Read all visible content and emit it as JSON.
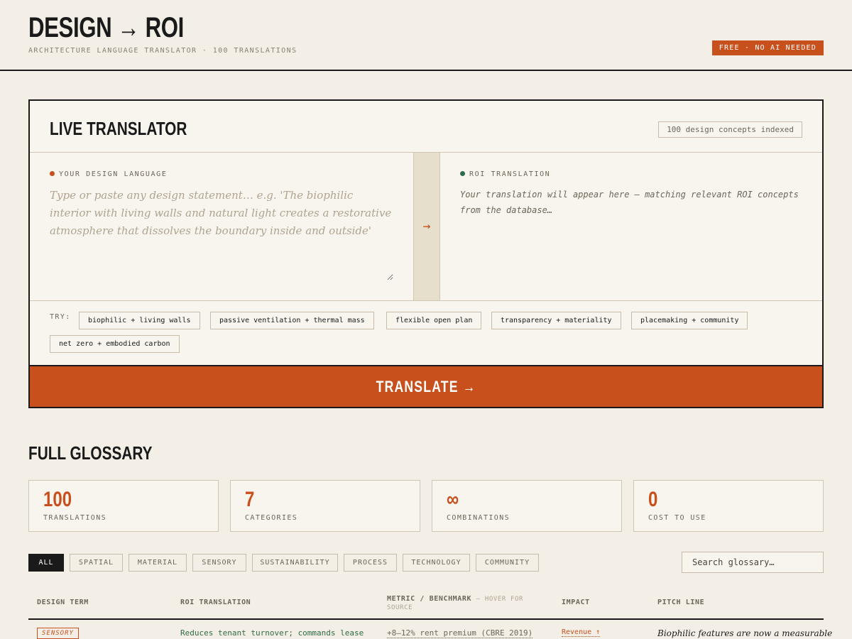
{
  "header": {
    "title": "DESIGN → ROI",
    "subtitle": "ARCHITECTURE LANGUAGE TRANSLATOR · 100 TRANSLATIONS",
    "badge": "FREE · NO AI NEEDED"
  },
  "translator": {
    "title": "LIVE TRANSLATOR",
    "indexed_badge": "100 design concepts indexed",
    "input_label": "YOUR DESIGN LANGUAGE",
    "input_placeholder": "Type or paste any design statement… e.g. 'The biophilic interior with living walls and natural light creates a restorative atmosphere that dissolves the boundary inside and outside'",
    "arrow": "→",
    "output_label": "ROI TRANSLATION",
    "output_placeholder": "Your translation will appear here — matching relevant ROI concepts from the database…",
    "try_label": "TRY:",
    "chips": [
      "biophilic + living walls",
      "passive ventilation + thermal mass",
      "flexible open plan",
      "transparency + materiality",
      "placemaking + community",
      "net zero + embodied carbon"
    ],
    "translate_label": "TRANSLATE →"
  },
  "glossary": {
    "title": "FULL GLOSSARY",
    "stats": [
      {
        "value": "100",
        "label": "TRANSLATIONS"
      },
      {
        "value": "7",
        "label": "CATEGORIES"
      },
      {
        "value": "∞",
        "label": "COMBINATIONS"
      },
      {
        "value": "0",
        "label": "COST TO USE"
      }
    ],
    "filters": [
      "ALL",
      "SPATIAL",
      "MATERIAL",
      "SENSORY",
      "SUSTAINABILITY",
      "PROCESS",
      "TECHNOLOGY",
      "COMMUNITY"
    ],
    "active_filter": "ALL",
    "search_placeholder": "Search glossary…",
    "columns": {
      "term": "DESIGN TERM",
      "roi": "ROI TRANSLATION",
      "metric": "METRIC / BENCHMARK",
      "metric_hint": "— HOVER FOR SOURCE",
      "impact": "IMPACT",
      "pitch": "PITCH LINE"
    },
    "rows": [
      {
        "category": "SENSORY",
        "roi": "Reduces tenant turnover; commands lease",
        "metric": "+8–12% rent premium (CBRE 2019)",
        "impact": "Revenue ↑",
        "pitch": "Biophilic features are now a measurable"
      }
    ]
  },
  "colors": {
    "accent": "#c8501c",
    "ink": "#1a1a1a",
    "paper": "#f3efe7",
    "panel": "#f8f5ef",
    "green": "#2e6b4a"
  }
}
